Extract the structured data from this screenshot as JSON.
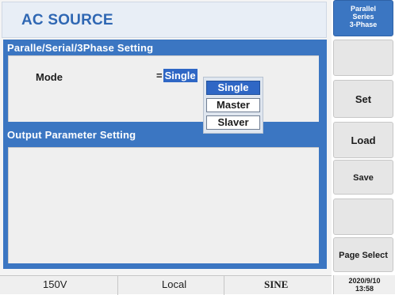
{
  "header": {
    "title": "AC SOURCE"
  },
  "panels": {
    "parallel_setting": {
      "title": "Paralle/Serial/3Phase  Setting",
      "mode": {
        "label": "Mode",
        "prefix": "=",
        "value": "Single"
      }
    },
    "output_parameter": {
      "title": "Output Parameter  Setting"
    }
  },
  "mode_dropdown": {
    "options": [
      "Single",
      "Master",
      "Slaver"
    ],
    "selected": "Single"
  },
  "side_buttons": {
    "parallel_series_3phase": {
      "line1": "Parallel",
      "line2": "Series",
      "line3": "3-Phase"
    },
    "blank1": "",
    "set": "Set",
    "load": "Load",
    "save": "Save",
    "blank2": "",
    "page_select": "Page Select"
  },
  "status_bar": {
    "voltage": "150V",
    "control": "Local",
    "waveform": "SINE"
  },
  "clock": {
    "date": "2020/9/10",
    "time": "13:58"
  },
  "colors": {
    "panel_blue": "#3b76c2",
    "title_blue": "#2f67b3",
    "selection_blue": "#2f67c5"
  }
}
